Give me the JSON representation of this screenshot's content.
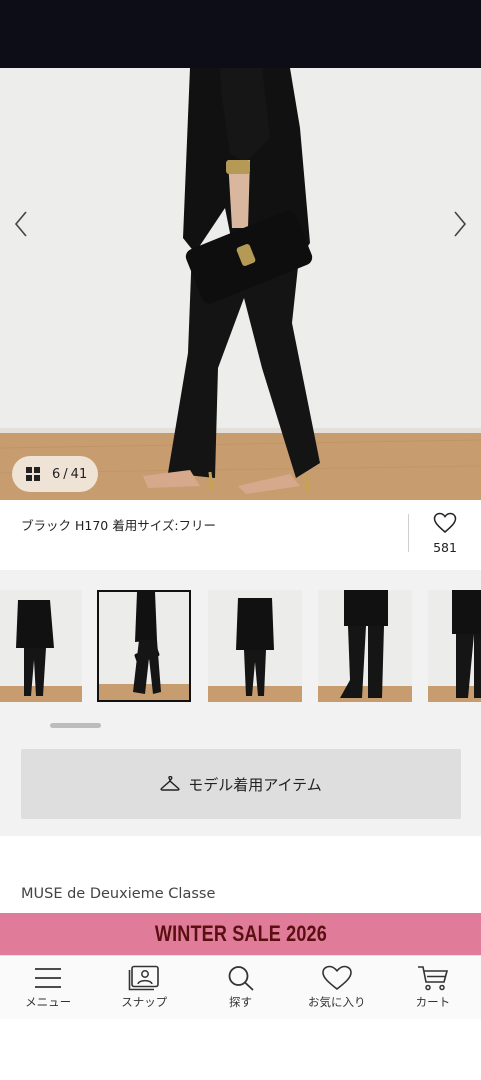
{
  "gallery": {
    "current": "6",
    "total": "41",
    "separator": "/",
    "caption": "ブラック H170 着用サイズ:フリー",
    "favorite_count": "581"
  },
  "model_button": {
    "label": "モデル着用アイテム"
  },
  "brand": {
    "name": "MUSE de Deuxieme Classe"
  },
  "banner": {
    "text": "WINTER SALE 2026",
    "background": "#e07b9a",
    "text_color": "#5a1010"
  },
  "bottom_nav": {
    "items": [
      {
        "label": "メニュー",
        "icon": "menu-icon"
      },
      {
        "label": "スナップ",
        "icon": "snap-icon"
      },
      {
        "label": "探す",
        "icon": "search-icon"
      },
      {
        "label": "お気に入り",
        "icon": "heart-icon"
      },
      {
        "label": "カート",
        "icon": "cart-icon"
      }
    ]
  },
  "colors": {
    "status_bar": "#0d0d17",
    "accent_banner": "#e07b9a"
  }
}
